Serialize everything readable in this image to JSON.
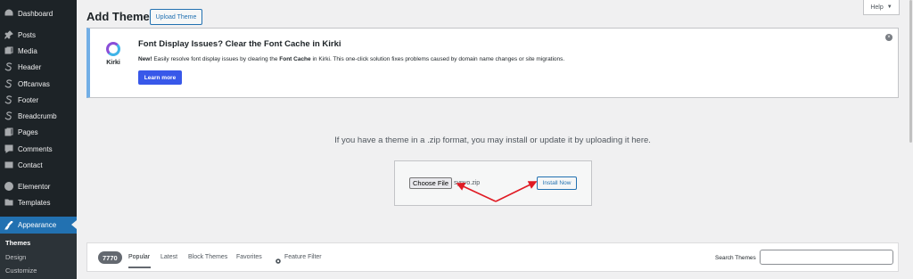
{
  "sidebar": {
    "items": [
      {
        "label": "Dashboard",
        "icon": "dashboard-icon"
      },
      {
        "label": "Posts",
        "icon": "pin-icon"
      },
      {
        "label": "Media",
        "icon": "media-icon"
      },
      {
        "label": "Header",
        "icon": "kirki-s-icon"
      },
      {
        "label": "Offcanvas",
        "icon": "kirki-s-icon"
      },
      {
        "label": "Footer",
        "icon": "kirki-s-icon"
      },
      {
        "label": "Breadcrumb",
        "icon": "kirki-s-icon"
      },
      {
        "label": "Pages",
        "icon": "pages-icon"
      },
      {
        "label": "Comments",
        "icon": "comment-icon"
      },
      {
        "label": "Contact",
        "icon": "mail-icon"
      },
      {
        "label": "Elementor",
        "icon": "elementor-icon"
      },
      {
        "label": "Templates",
        "icon": "folder-icon"
      },
      {
        "label": "Appearance",
        "icon": "brush-icon"
      }
    ],
    "submenu": [
      "Themes",
      "Design",
      "Customize"
    ]
  },
  "header": {
    "title": "Add Themes",
    "upload_button": "Upload Theme",
    "help": "Help"
  },
  "notice": {
    "logo_text": "Kirki",
    "title": "Font Display Issues? Clear the Font Cache in Kirki",
    "new_label": "New!",
    "body_1": " Easily resolve font display issues by clearing the ",
    "body_bold": "Font Cache",
    "body_2": " in Kirki. This one-click solution fixes problems caused by domain name changes or site migrations.",
    "button": "Learn more"
  },
  "upload": {
    "instruction": "If you have a theme in a .zip format, you may install or update it by uploading it here.",
    "choose_file": "Choose File",
    "file_name": "synvo.zip",
    "install_button": "Install Now"
  },
  "filters": {
    "count": "7770",
    "links": [
      "Popular",
      "Latest",
      "Block Themes",
      "Favorites",
      "Feature Filter"
    ],
    "search_label": "Search Themes",
    "search_value": ""
  },
  "colors": {
    "sidebar_bg": "#1d2327",
    "accent": "#2271b1",
    "notice_border": "#72aee6",
    "learn_more": "#3858e9",
    "annotation_arrow": "#e01b24"
  }
}
